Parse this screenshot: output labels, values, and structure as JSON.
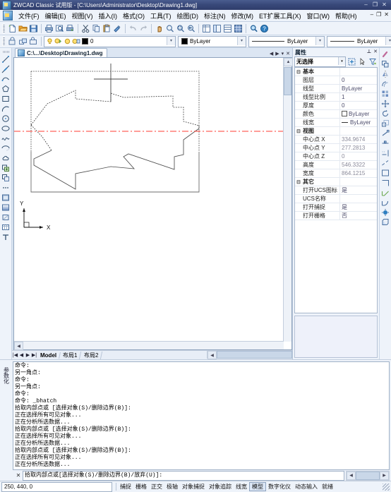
{
  "window": {
    "title": "ZWCAD Classic 试用版 - [C:\\Users\\Administrator\\Desktop\\Drawing1.dwg]",
    "minimize": "–",
    "maximize": "❐",
    "close": "✕"
  },
  "menu": {
    "items": [
      {
        "label": "文件(F)",
        "name": "menu-file"
      },
      {
        "label": "编辑(E)",
        "name": "menu-edit"
      },
      {
        "label": "视图(V)",
        "name": "menu-view"
      },
      {
        "label": "插入(I)",
        "name": "menu-insert"
      },
      {
        "label": "格式(O)",
        "name": "menu-format"
      },
      {
        "label": "工具(T)",
        "name": "menu-tools"
      },
      {
        "label": "绘图(D)",
        "name": "menu-draw"
      },
      {
        "label": "标注(N)",
        "name": "menu-dimension"
      },
      {
        "label": "修改(M)",
        "name": "menu-modify"
      },
      {
        "label": "ET扩展工具(X)",
        "name": "menu-express"
      },
      {
        "label": "窗口(W)",
        "name": "menu-window"
      },
      {
        "label": "帮助(H)",
        "name": "menu-help"
      }
    ],
    "doc_minimize": "–",
    "doc_restore": "❐",
    "doc_close": "✕"
  },
  "toolbar_standard": {
    "buttons": [
      {
        "name": "new-file-icon",
        "tip": "新建"
      },
      {
        "name": "open-file-icon",
        "tip": "打开"
      },
      {
        "name": "save-icon",
        "tip": "保存"
      },
      {
        "name": "print-icon",
        "tip": "打印"
      },
      {
        "name": "print-preview-icon",
        "tip": "打印预览"
      },
      {
        "name": "publish-icon",
        "tip": "发布"
      },
      {
        "name": "cut-icon",
        "tip": "剪切"
      },
      {
        "name": "copy-icon",
        "tip": "复制"
      },
      {
        "name": "paste-icon",
        "tip": "粘贴"
      },
      {
        "name": "match-properties-icon",
        "tip": "特性匹配"
      },
      {
        "name": "undo-icon",
        "tip": "放弃"
      },
      {
        "name": "redo-icon",
        "tip": "重做"
      },
      {
        "name": "pan-icon",
        "tip": "实时平移"
      },
      {
        "name": "zoom-realtime-icon",
        "tip": "实时缩放"
      },
      {
        "name": "zoom-window-icon",
        "tip": "窗口缩放"
      },
      {
        "name": "zoom-previous-icon",
        "tip": "缩放上一个"
      },
      {
        "name": "properties-panel-icon",
        "tip": "特性"
      },
      {
        "name": "designcenter-icon",
        "tip": "设计中心"
      },
      {
        "name": "tool-palette-icon",
        "tip": "工具选项板"
      },
      {
        "name": "blocks-icon",
        "tip": "块"
      },
      {
        "name": "search-icon",
        "tip": "查找"
      },
      {
        "name": "help-icon",
        "tip": "帮助"
      }
    ]
  },
  "toolbar_layer": {
    "layer_buttons": [
      {
        "name": "layer-properties-icon"
      },
      {
        "name": "layer-previous-icon"
      },
      {
        "name": "layer-state-icon"
      }
    ],
    "layer_value": "0",
    "color_value": "ByLayer",
    "linetype_value": "ByLayer",
    "lineweight_value": "ByLayer",
    "color_swatch": "#000000",
    "layer_panel_icon": "layer-manager-icon"
  },
  "draw_toolbar": {
    "tools": [
      {
        "name": "line-tool-icon"
      },
      {
        "name": "construction-line-tool-icon"
      },
      {
        "name": "polyline-tool-icon"
      },
      {
        "name": "polygon-tool-icon"
      },
      {
        "name": "rectangle-tool-icon"
      },
      {
        "name": "arc-tool-icon"
      },
      {
        "name": "circle-tool-icon"
      },
      {
        "name": "ellipse-tool-icon"
      },
      {
        "name": "spline-tool-icon"
      },
      {
        "name": "ellipse-arc-tool-icon"
      },
      {
        "name": "revision-cloud-tool-icon"
      },
      {
        "name": "insert-block-tool-icon"
      },
      {
        "name": "make-block-tool-icon"
      },
      {
        "name": "point-tool-icon"
      },
      {
        "name": "hatch-tool-icon"
      },
      {
        "name": "gradient-tool-icon"
      },
      {
        "name": "region-tool-icon"
      },
      {
        "name": "table-tool-icon"
      },
      {
        "name": "multiline-text-tool-icon"
      }
    ]
  },
  "modify_toolbar": {
    "tools": [
      {
        "name": "erase-tool-icon"
      },
      {
        "name": "copy-tool-icon"
      },
      {
        "name": "mirror-tool-icon"
      },
      {
        "name": "offset-tool-icon"
      },
      {
        "name": "array-tool-icon"
      },
      {
        "name": "move-tool-icon"
      },
      {
        "name": "rotate-tool-icon"
      },
      {
        "name": "scale-tool-icon"
      },
      {
        "name": "stretch-tool-icon"
      },
      {
        "name": "trim-tool-icon"
      },
      {
        "name": "extend-tool-icon"
      },
      {
        "name": "break-at-point-tool-icon"
      },
      {
        "name": "break-tool-icon"
      },
      {
        "name": "join-tool-icon"
      },
      {
        "name": "chamfer-tool-icon"
      },
      {
        "name": "fillet-tool-icon"
      },
      {
        "name": "explode-tool-icon"
      },
      {
        "name": "3d-tool-icon"
      }
    ]
  },
  "document": {
    "tab_label": "C:\\...\\Desktop\\Drawing1.dwg",
    "nav_prev": "◀",
    "nav_next": "▶",
    "nav_list": "▾",
    "nav_close": "✕"
  },
  "layout_tabs": {
    "first": "|◀",
    "prev": "◀",
    "next": "▶",
    "last": "▶|",
    "tabs": [
      {
        "label": "Model",
        "active": true,
        "name": "tab-model"
      },
      {
        "label": "布局1",
        "active": false,
        "name": "tab-layout1"
      },
      {
        "label": "布局2",
        "active": false,
        "name": "tab-layout2"
      }
    ]
  },
  "properties": {
    "panel_title": "属性",
    "pin": "⊥",
    "close": "✕",
    "selection": "无选择",
    "header_buttons": [
      {
        "name": "quick-select-icon"
      },
      {
        "name": "select-objects-icon"
      },
      {
        "name": "filter-icon"
      }
    ],
    "groups": [
      {
        "name": "基本",
        "rows": [
          {
            "label": "图层",
            "value": "0",
            "type": "text"
          },
          {
            "label": "线型",
            "value": "ByLayer",
            "type": "text"
          },
          {
            "label": "线型比例",
            "value": "1",
            "type": "text"
          },
          {
            "label": "厚度",
            "value": "0",
            "type": "text"
          },
          {
            "label": "颜色",
            "value": "ByLayer",
            "type": "color"
          },
          {
            "label": "线宽",
            "value": "ByLayer",
            "type": "lineweight"
          }
        ]
      },
      {
        "name": "视图",
        "rows": [
          {
            "label": "中心点 X",
            "value": "334.9674",
            "type": "gray"
          },
          {
            "label": "中心点 Y",
            "value": "277.2813",
            "type": "gray"
          },
          {
            "label": "中心点 Z",
            "value": "0",
            "type": "gray"
          },
          {
            "label": "高度",
            "value": "546.3322",
            "type": "gray"
          },
          {
            "label": "宽度",
            "value": "864.1215",
            "type": "gray"
          }
        ]
      },
      {
        "name": "其它",
        "rows": [
          {
            "label": "打开UCS图标",
            "value": "是",
            "type": "text"
          },
          {
            "label": "UCS名称",
            "value": "",
            "type": "text"
          },
          {
            "label": "打开捕捉",
            "value": "是",
            "type": "text"
          },
          {
            "label": "打开栅格",
            "value": "否",
            "type": "text"
          }
        ]
      }
    ]
  },
  "command_area": {
    "side_label": "参数化",
    "history": [
      "命令:",
      "另一角点:",
      "命令:",
      "另一角点:",
      "命令:",
      "命令: _bhatch",
      "拾取内部点或 [选择对象(S)/删除边界(B)]:",
      "正在选择所有可见对象...",
      "正在分析所选数据...",
      "拾取内部点或 [选择对象(S)/删除边界(B)]:",
      "正在选择所有可见对象...",
      "正在分析所选数据...",
      "拾取内部点或 [选择对象(S)/删除边界(B)]:",
      "正在选择所有可见对象...",
      "正在分析所选数据..."
    ],
    "close_label": "✕",
    "prompt": "拾取内部点或[选择对象(S)/删除边界(B)/放弃(U)]:"
  },
  "statusbar": {
    "coordinates": "250, 440, 0",
    "toggles": [
      {
        "label": "捕捉",
        "active": false,
        "name": "status-snap"
      },
      {
        "label": "栅格",
        "active": false,
        "name": "status-grid"
      },
      {
        "label": "正交",
        "active": false,
        "name": "status-ortho"
      },
      {
        "label": "极轴",
        "active": false,
        "name": "status-polar"
      },
      {
        "label": "对象捕捉",
        "active": false,
        "name": "status-osnap"
      },
      {
        "label": "对象追踪",
        "active": false,
        "name": "status-otrack"
      },
      {
        "label": "线宽",
        "active": false,
        "name": "status-lineweight"
      },
      {
        "label": "模型",
        "active": true,
        "name": "status-model"
      },
      {
        "label": "数字化仪",
        "active": false,
        "name": "status-tablet"
      },
      {
        "label": "动态输入",
        "active": false,
        "name": "status-dyninput"
      },
      {
        "label": "就绪",
        "active": false,
        "name": "status-ready"
      }
    ]
  },
  "drawing": {
    "ucs_x_label": "X",
    "ucs_y_label": "Y",
    "colors": {
      "boundary": "#333333",
      "centerline": "#ff3b30",
      "crosshair": "#444444"
    }
  }
}
